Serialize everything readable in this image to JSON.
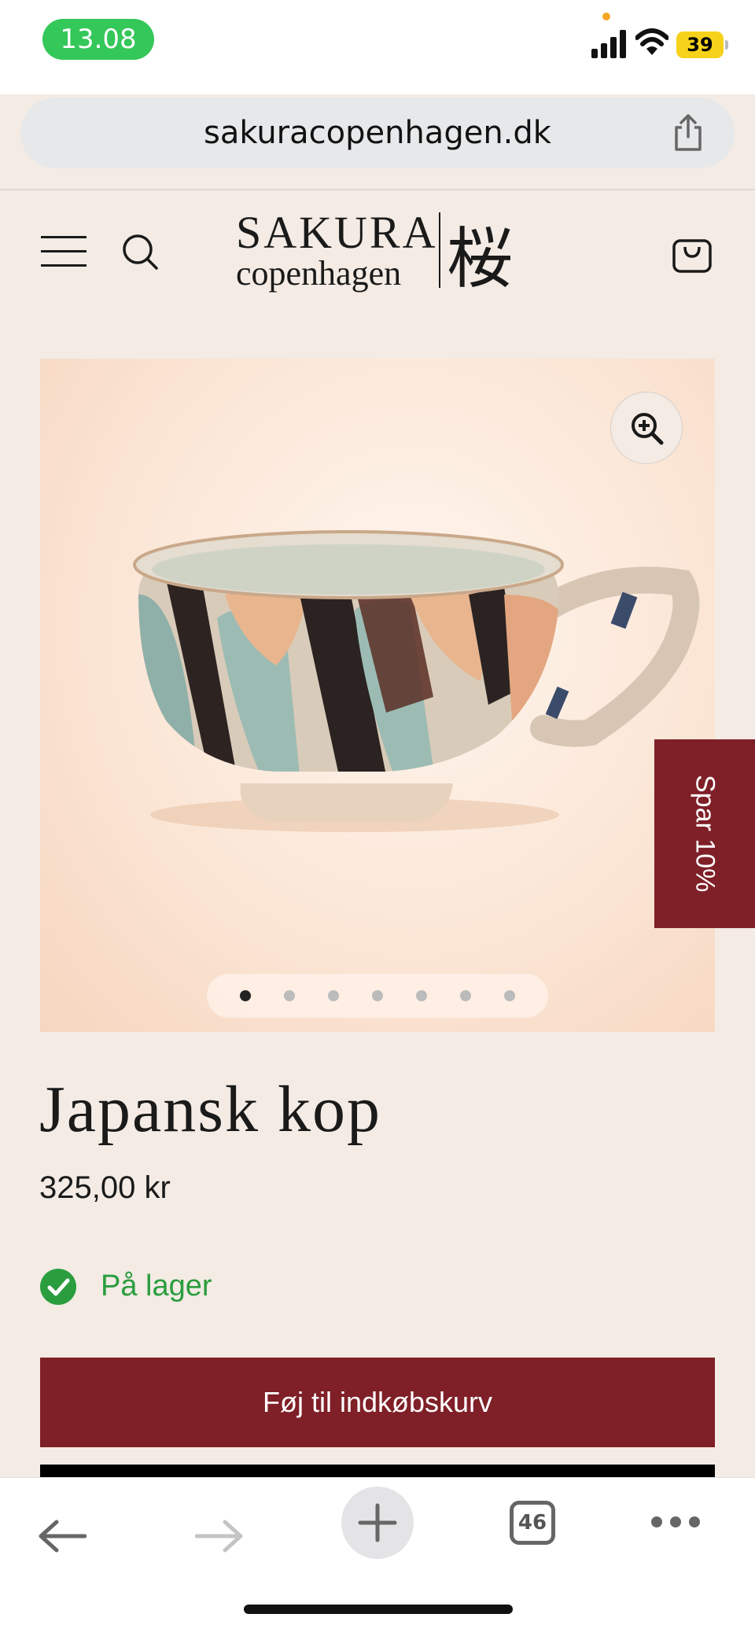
{
  "status_bar": {
    "time": "13.08",
    "battery": "39"
  },
  "browser": {
    "url": "sakuracopenhagen.dk",
    "tab_count": "46"
  },
  "header": {
    "logo_line1": "SAKURA",
    "logo_line2": "copenhagen",
    "logo_kanji": "桜"
  },
  "product": {
    "title": "Japansk kop",
    "price": "325,00 kr",
    "stock_status": "På lager",
    "add_to_cart_label": "Føj til indkøbskurv",
    "image_count": 7,
    "active_image": 1
  },
  "promo_tab": {
    "label": "Spar 10%"
  },
  "colors": {
    "brand": "#7f1f27",
    "background": "#f3ebe4",
    "in_stock": "#2a9d3e",
    "status_time": "#34c759"
  },
  "icons": [
    "menu-icon",
    "search-icon",
    "cart-icon",
    "zoom-in-icon",
    "share-icon",
    "back-arrow-icon",
    "forward-arrow-icon",
    "plus-icon",
    "more-icon",
    "check-circle-icon"
  ]
}
